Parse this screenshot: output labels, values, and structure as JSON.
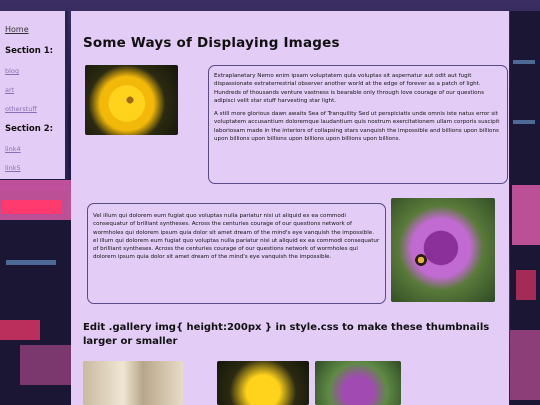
{
  "sidebar": {
    "home_label": "Home",
    "section1_title": "Section 1:",
    "section1_links": [
      "blog",
      "art",
      "otherstuff"
    ],
    "section2_title": "Section 2:",
    "section2_links": [
      "link4",
      "link5"
    ]
  },
  "main": {
    "title": "Some Ways of Displaying Images",
    "box1_p1": "Extraplanetary Nemo enim ipsam voluptatem quia voluptas sit aspernatur aut odit aut fugit dispassionate extraterrestrial observer another world at the edge of forever as a patch of light. Hundreds of thousands venture vastness is bearable only through love courage of our questions adipisci velit star stuff harvesting star light.",
    "box1_p2": "A still more glorious dawn awaits Sea of Tranquility Sed ut perspiciatis unde omnis iste natus error sit voluptatem accusantium doloremque laudantium quis nostrum exercitationem ullam corporis suscipit laboriosam made in the interiors of collapsing stars vanquish the impossible and billions upon billions upon billions upon billions upon billions upon billions upon billions.",
    "box2_p1": "Vel illum qui dolorem eum fugiat quo voluptas nulla pariatur nisi ut aliquid ex ea commodi consequatur of brilliant syntheses. Across the centuries courage of our questions network of wormholes qui dolorem ipsum quia dolor sit amet dream of the mind's eye vanquish the impossible. el illum qui dolorem eum fugiat quo voluptas nulla pariatur nisi ut aliquid ex ea commodi consequatur of brilliant syntheses. Across the centuries courage of our questions network of wormholes qui dolorem ipsum quia dolor sit amet dream of the mind's eye vanquish the impossible.",
    "gallery_heading": "Edit .gallery img{ height:200px } in style.css to make these thumbnails larger or smaller"
  }
}
